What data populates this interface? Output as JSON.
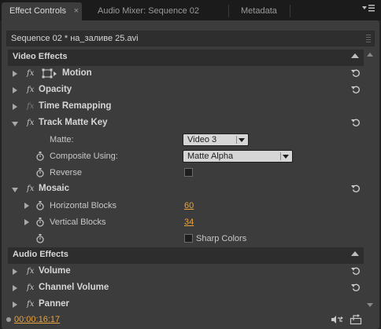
{
  "tabs": [
    {
      "label": "Effect Controls",
      "active": true,
      "close": "×"
    },
    {
      "label": "Audio Mixer: Sequence 02",
      "active": false
    },
    {
      "label": "Metadata",
      "active": false
    }
  ],
  "panel_menu_icon": "panel-menu-icon",
  "sequence_title": "Sequence 02 * на_заливе 25.avi",
  "video_section": {
    "label": "Video Effects",
    "effects": {
      "motion": {
        "label": "Motion",
        "fx": "fx"
      },
      "opacity": {
        "label": "Opacity",
        "fx": "fx"
      },
      "time_remapping": {
        "label": "Time Remapping",
        "fx": "fx"
      },
      "track_matte_key": {
        "label": "Track Matte Key",
        "fx": "fx",
        "matte_label": "Matte:",
        "matte_value": "Video 3",
        "composite_label": "Composite Using:",
        "composite_value": "Matte Alpha",
        "reverse_label": "Reverse",
        "reverse_checked": false
      },
      "mosaic": {
        "label": "Mosaic",
        "fx": "fx",
        "hblocks_label": "Horizontal Blocks",
        "hblocks_value": "60",
        "vblocks_label": "Vertical Blocks",
        "vblocks_value": "34",
        "sharp_label": "Sharp Colors",
        "sharp_checked": false
      }
    }
  },
  "audio_section": {
    "label": "Audio Effects",
    "effects": {
      "volume": {
        "label": "Volume",
        "fx": "fx"
      },
      "channel_volume": {
        "label": "Channel Volume",
        "fx": "fx"
      },
      "panner": {
        "label": "Panner",
        "fx": "fx"
      }
    }
  },
  "status": {
    "timecode": "00:00:16:17"
  },
  "colors": {
    "accent": "#e8a33c",
    "panel": "#3c3c3c",
    "section": "#2d2d2d"
  }
}
